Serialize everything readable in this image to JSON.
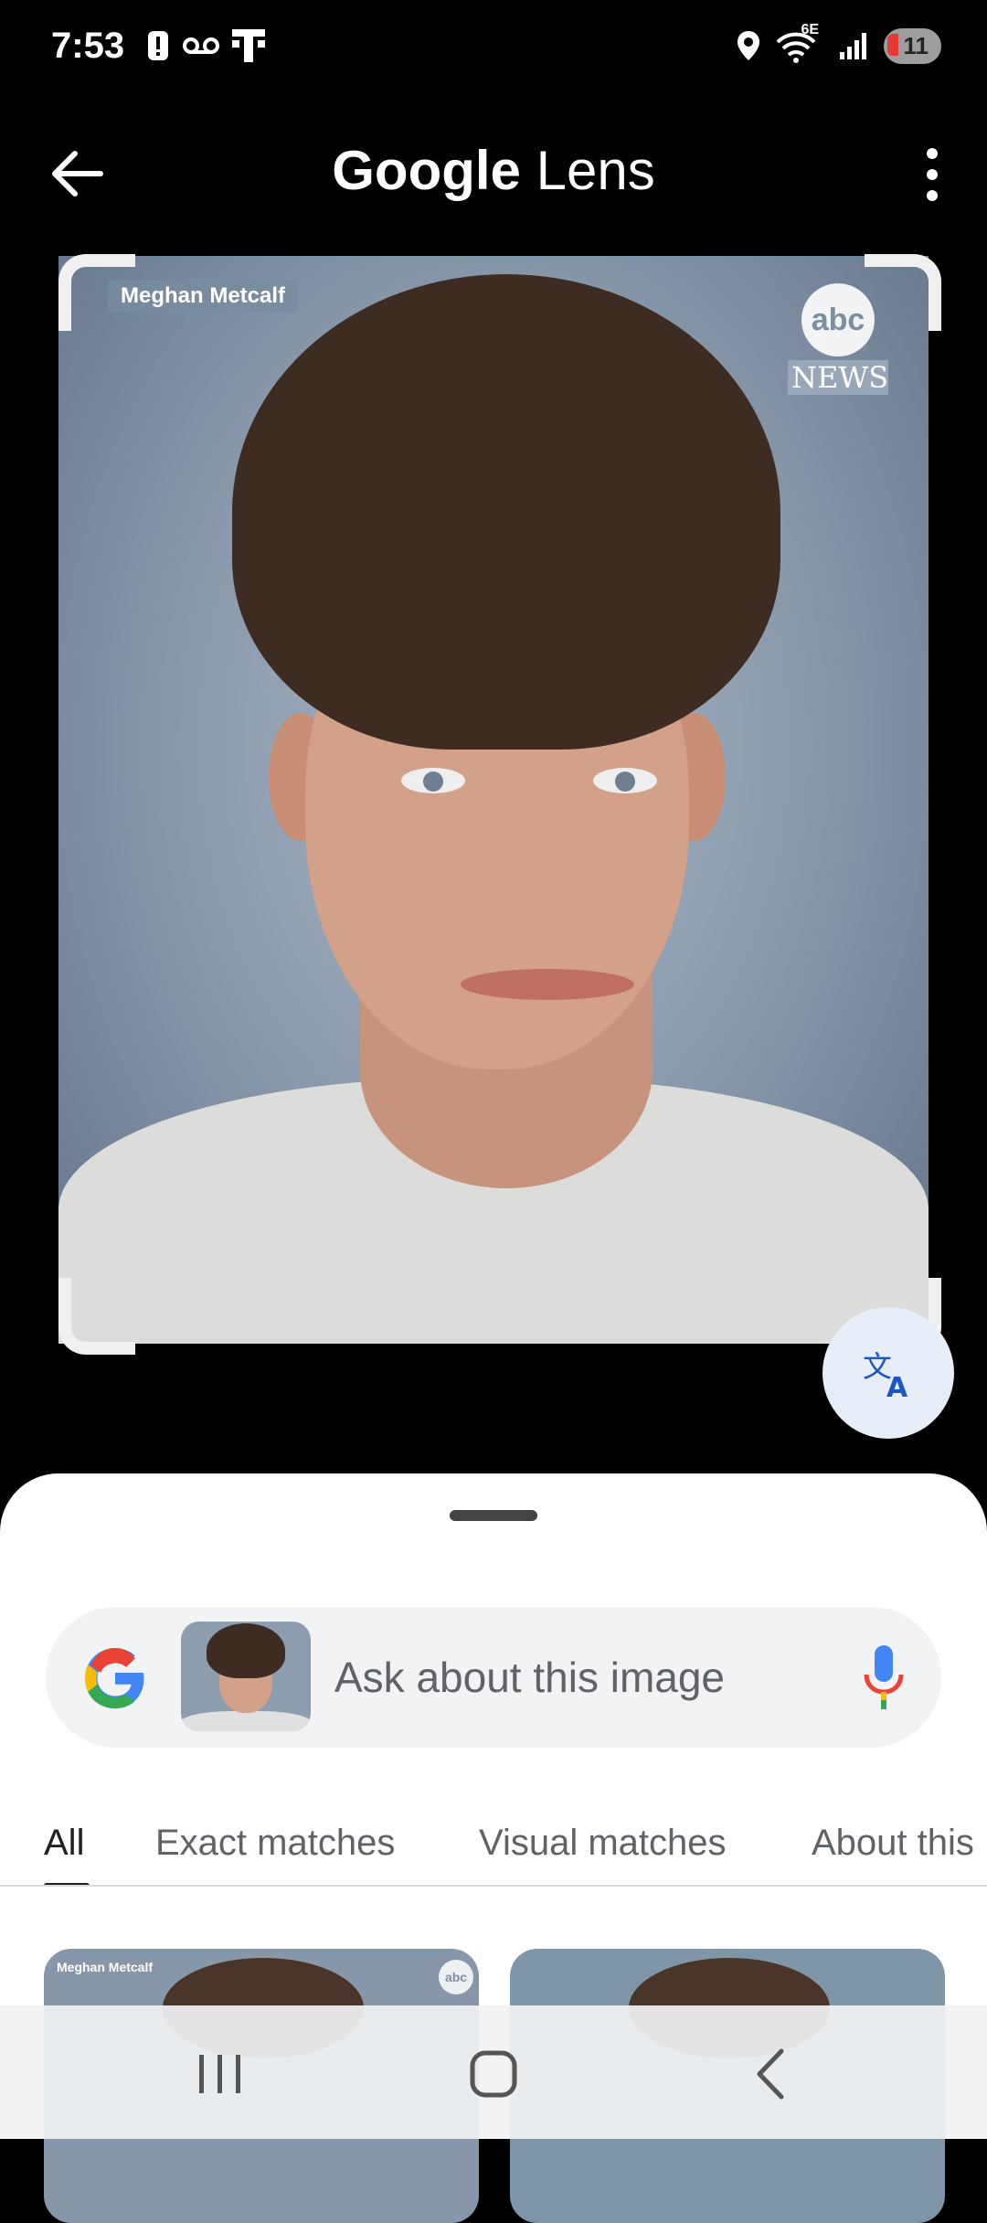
{
  "status_bar": {
    "time": "7:53",
    "network_label": "6E",
    "battery_level": "11",
    "left_icons": [
      "alert-icon",
      "voicemail-icon",
      "tmobile-icon"
    ],
    "right_icons": [
      "location-icon",
      "wifi-icon",
      "signal-icon",
      "battery-icon"
    ]
  },
  "header": {
    "title_part1": "Google",
    "title_part2": "Lens"
  },
  "image": {
    "caption_label": "Meghan Metcalf",
    "logo_text": "abc",
    "logo_subtext": "NEWS"
  },
  "search": {
    "placeholder": "Ask about this image"
  },
  "tabs": [
    "All",
    "Exact matches",
    "Visual matches",
    "About this"
  ],
  "active_tab": "All",
  "results": [
    {
      "caption": "Meghan Metcalf",
      "logo": "abc"
    },
    {}
  ],
  "colors": {
    "background": "#000000",
    "sheet": "#ffffff",
    "accent_blue": "#1a73e8",
    "search_box": "#f1f3f4"
  }
}
